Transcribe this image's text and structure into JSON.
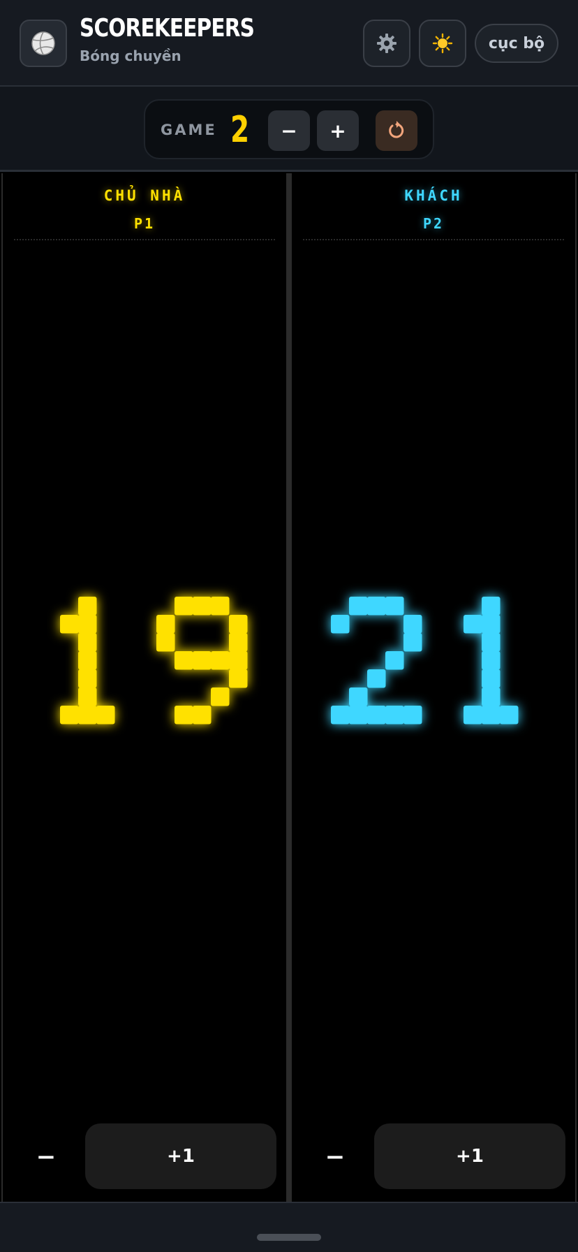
{
  "header": {
    "title": "SCOREKEEPERS",
    "subtitle": "Bóng chuyền",
    "logo_icon": "volleyball-icon",
    "settings_icon": "gear-icon",
    "theme_icon": "sun-icon",
    "mode_label": "cục bộ"
  },
  "game_bar": {
    "label": "GAME",
    "number": "2",
    "minus_label": "−",
    "plus_label": "+",
    "reset_icon": "reset-icon"
  },
  "teams": [
    {
      "team": "CHỦ NHÀ",
      "player": "P1",
      "score": "19",
      "color": "#ffe100",
      "dec_label": "−",
      "inc_label": "+1"
    },
    {
      "team": "KHÁCH",
      "player": "P2",
      "score": "21",
      "color": "#3fd7ff",
      "dec_label": "−",
      "inc_label": "+1"
    }
  ]
}
